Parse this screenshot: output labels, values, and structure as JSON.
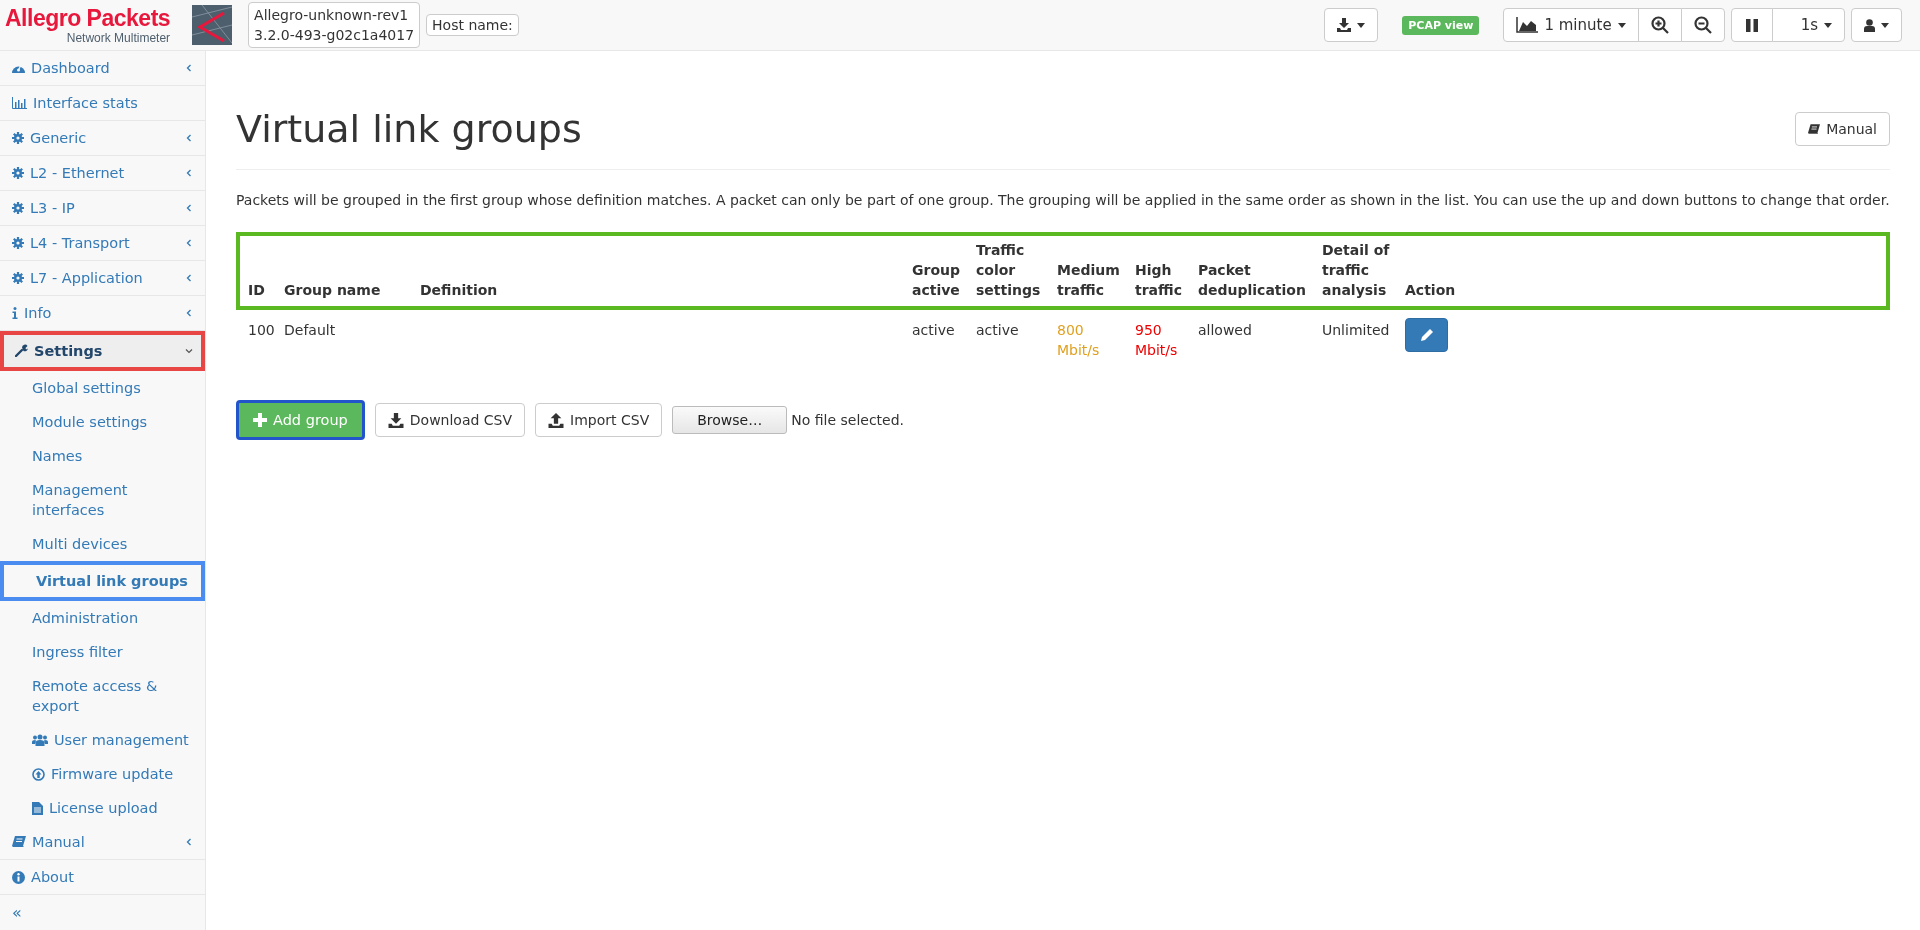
{
  "brand": {
    "name": "Allegro Packets",
    "tagline": "Network Multimeter"
  },
  "version": {
    "line_1": "Allegro-unknown-rev1",
    "line_2": "3.2.0-493-g02c1a4017"
  },
  "host": {
    "label": "Host name:"
  },
  "toolbar": {
    "pcap_badge": "PCAP view",
    "interval": "1 minute",
    "refresh": "1s"
  },
  "sidebar": {
    "items": [
      {
        "label": "Dashboard",
        "expanded": false,
        "selected": false
      },
      {
        "label": "Interface stats",
        "selected": false
      },
      {
        "label": "Generic",
        "expanded": false,
        "selected": false
      },
      {
        "label": "L2 - Ethernet",
        "expanded": false,
        "selected": false
      },
      {
        "label": "L3 - IP",
        "expanded": false,
        "selected": false
      },
      {
        "label": "L4 - Transport",
        "expanded": false,
        "selected": false
      },
      {
        "label": "L7 - Application",
        "expanded": false,
        "selected": false
      },
      {
        "label": "Info",
        "expanded": false,
        "selected": false
      },
      {
        "label": "Settings",
        "expanded": true,
        "selected": true,
        "color": "#e84545",
        "children": [
          {
            "label": "Global settings",
            "selected": false
          },
          {
            "label": "Module settings",
            "selected": false
          },
          {
            "label": "Names",
            "selected": false
          },
          {
            "label": "Management interfaces",
            "selected": false
          },
          {
            "label": "Multi devices",
            "selected": false
          },
          {
            "label": "Virtual link groups",
            "selected": true,
            "color": "#4a8cf0"
          },
          {
            "label": "Administration",
            "selected": false
          },
          {
            "label": "Ingress filter",
            "selected": false
          },
          {
            "label": "Remote access & export",
            "selected": false
          },
          {
            "label": "User management",
            "selected": false
          },
          {
            "label": "Firmware update",
            "selected": false
          },
          {
            "label": "License upload",
            "selected": false
          }
        ]
      },
      {
        "label": "Manual",
        "expanded": false,
        "selected": false
      },
      {
        "label": "About",
        "selected": false
      }
    ],
    "collapse": "«"
  },
  "page": {
    "title": "Virtual link groups",
    "manual_button": "Manual",
    "description": "Packets will be grouped in the first group whose definition matches. A packet can only be part of one group. The grouping will be applied in the same order as shown in the list. You can use the up and down buttons to change that order."
  },
  "table": {
    "header_highlighted": true,
    "columns": [
      "ID",
      "Group name",
      "Definition",
      "Group active",
      "Traffic color settings",
      "Medium traffic",
      "High traffic",
      "Packet deduplication",
      "Detail of traffic analysis",
      "Action"
    ],
    "rows": [
      {
        "id": "100",
        "group_name": "Default",
        "group_active": "active",
        "traffic_color_settings": "active",
        "medium_traffic": "800 Mbit/s",
        "high_traffic": "950 Mbit/s",
        "packet_deduplication": "allowed",
        "detail_of_traffic_analysis": "Unlimited"
      }
    ]
  },
  "actions": {
    "add_group": "Add group",
    "download_csv": "Download CSV",
    "import_csv": "Import CSV",
    "browse": "Browse…",
    "file_status": "No file selected."
  }
}
